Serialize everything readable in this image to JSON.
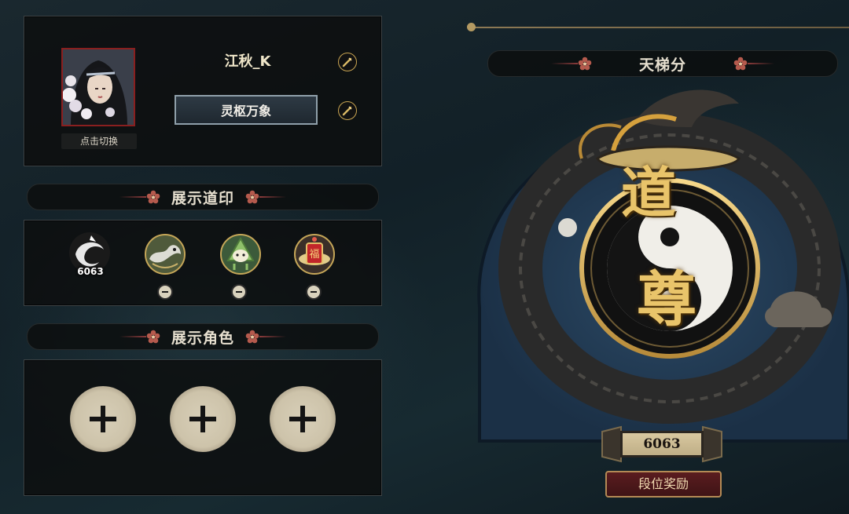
{
  "profile": {
    "name": "江秋_K",
    "title": "灵枢万象",
    "switch_label": "点击切换"
  },
  "seals_section": {
    "title": "展示道印",
    "seals": [
      {
        "icon": "ink-swirl-seal",
        "value": "6063"
      },
      {
        "icon": "dragon-seal"
      },
      {
        "icon": "zongzi-seal"
      },
      {
        "icon": "fortune-lantern-seal",
        "glyph": "福"
      }
    ]
  },
  "characters_section": {
    "title": "展示角色",
    "slots": [
      "add",
      "add",
      "add"
    ]
  },
  "ladder": {
    "title": "天梯分",
    "rank_chars": [
      "道",
      "尊"
    ],
    "score": "6063",
    "reward_button": "段位奖励"
  },
  "colors": {
    "gold": "#c9a552",
    "crimson": "#8c3b3b",
    "panel": "#0c0e0e"
  }
}
